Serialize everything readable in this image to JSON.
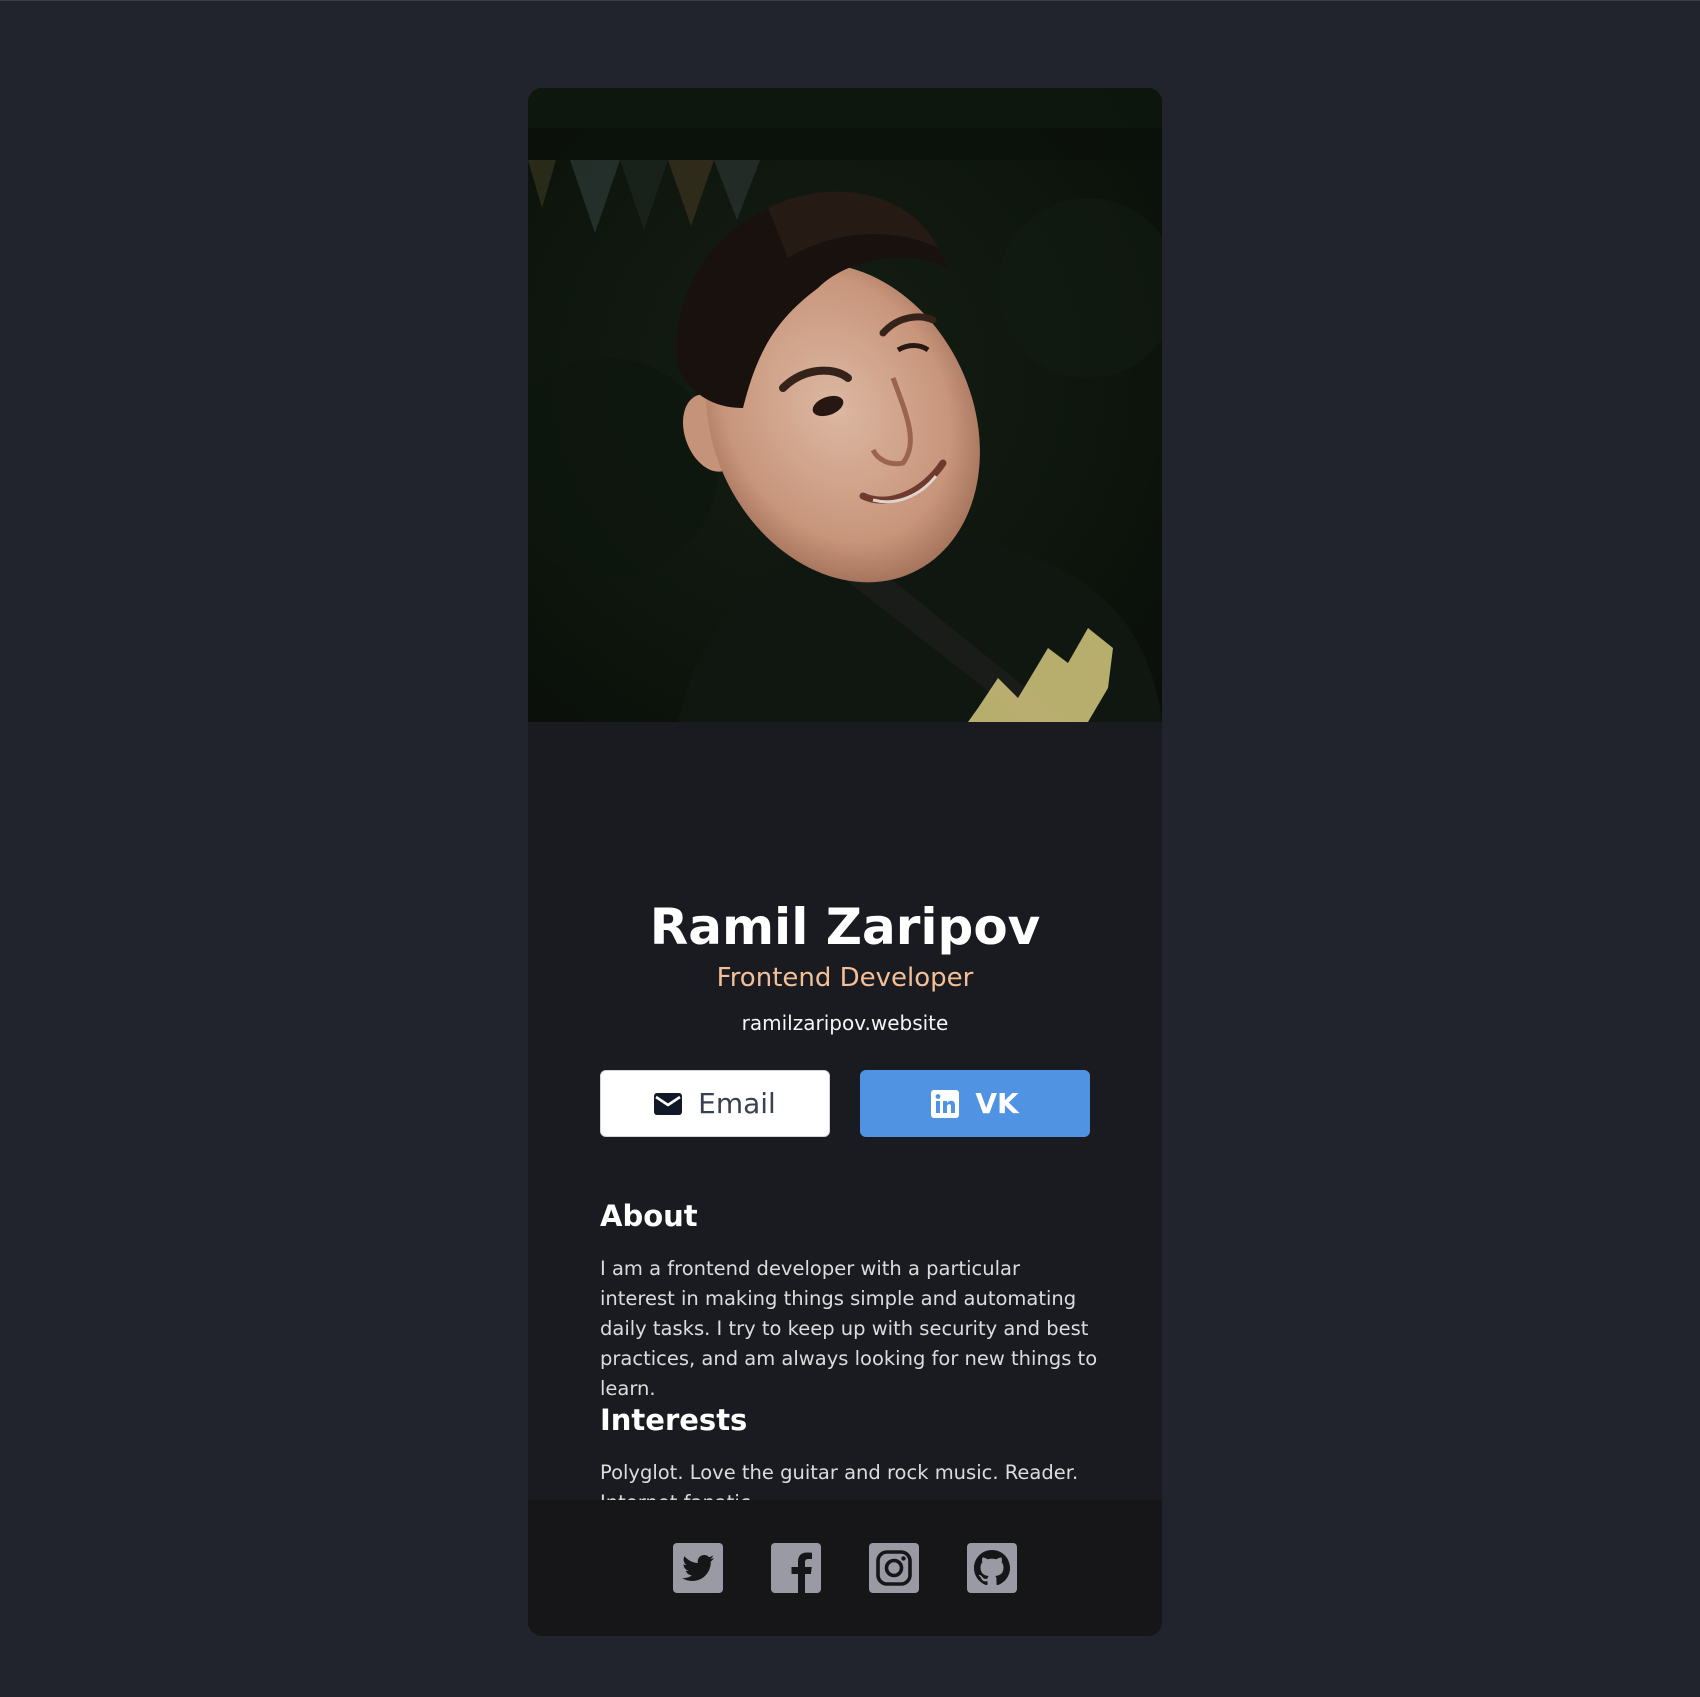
{
  "profile": {
    "name": "Ramil Zaripov",
    "role": "Frontend Developer",
    "website": "ramilzaripov.website"
  },
  "buttons": {
    "email_label": "Email",
    "email_icon": "envelope-icon",
    "vk_label": "VK",
    "vk_icon": "linkedin-icon"
  },
  "about": {
    "title": "About",
    "text": "I am a frontend developer with a particular interest in making things simple and automating daily tasks. I try to keep up with security and best practices, and am always looking for new things to learn."
  },
  "interests": {
    "title": "Interests",
    "text": "Polyglot. Love the guitar and rock music. Reader. Internet fanatic."
  },
  "footer": {
    "social_icons": [
      "twitter-icon",
      "facebook-icon",
      "instagram-icon",
      "github-icon"
    ]
  },
  "colors": {
    "page_background": "#21242d",
    "card_background": "#1a1b20",
    "footer_background": "#161619",
    "accent": "#f3bf99",
    "vk_button": "#5093e2",
    "social_icon": "#9a9aa4"
  }
}
